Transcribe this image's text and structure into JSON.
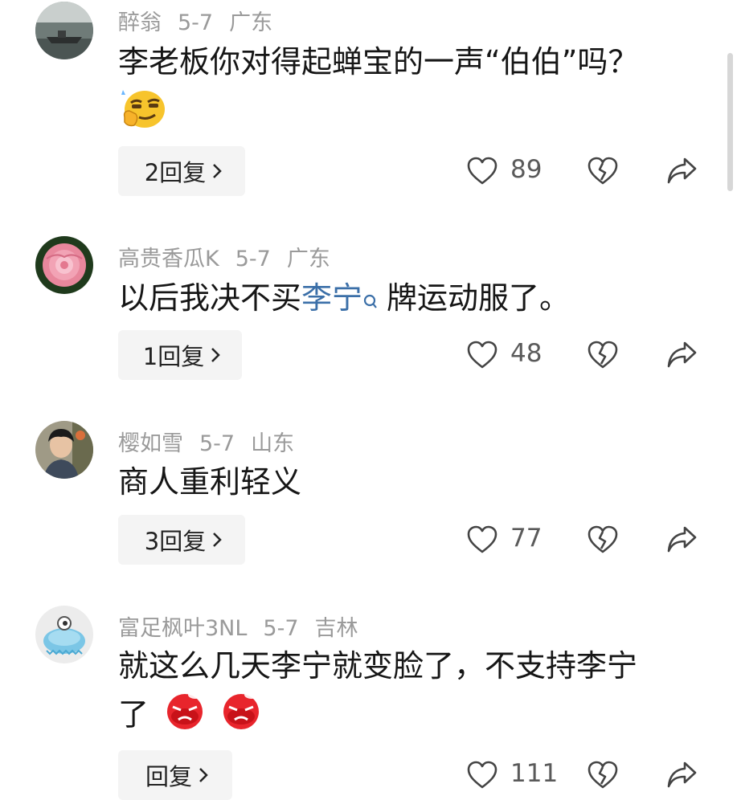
{
  "comments": [
    {
      "username": "醉翁",
      "date": "5-7",
      "location": "广东",
      "text": "李老板你对得起蝉宝的一声“伯伯”吗？",
      "emoji": "smirk-thinking-emoji",
      "reply_label": "2回复",
      "likes": "89"
    },
    {
      "username": "高贵香瓜K",
      "date": "5-7",
      "location": "广东",
      "text_before": "以后我决不买",
      "text_link": "李宁",
      "text_after": "牌运动服了。",
      "reply_label": "1回复",
      "likes": "48"
    },
    {
      "username": "樱如雪",
      "date": "5-7",
      "location": "山东",
      "text": "商人重利轻义",
      "reply_label": "3回复",
      "likes": "77"
    },
    {
      "username": "富足枫叶3NL",
      "date": "5-7",
      "location": "吉林",
      "text_line1": "就这么几天李宁就变脸了，不支持李宁",
      "text_line2": "了",
      "emoji": "angry-face-emoji",
      "reply_label": "回复",
      "likes": "111"
    }
  ],
  "icons": {
    "like": "heart-outline-icon",
    "dislike": "broken-heart-icon",
    "share": "share-arrow-icon",
    "search": "search-icon",
    "chevron": "chevron-right-icon"
  },
  "colors": {
    "link": "#3b6fa8",
    "meta": "#9a9a9a",
    "pill": "#f4f4f4"
  }
}
